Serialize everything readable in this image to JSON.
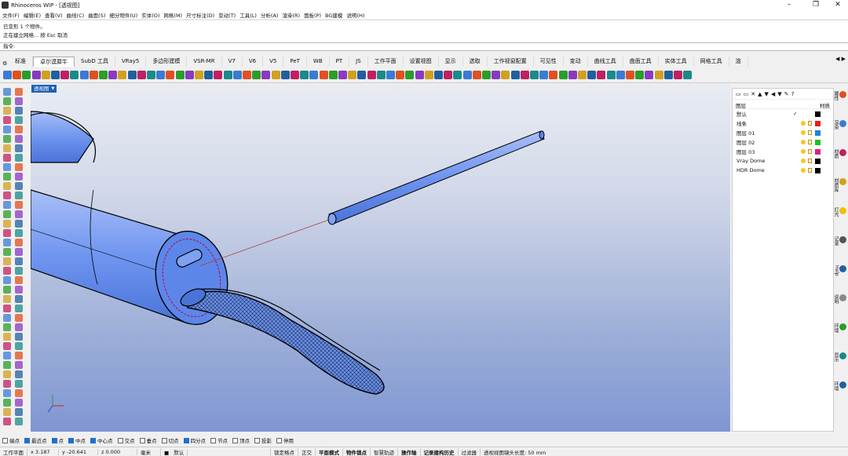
{
  "window": {
    "title": "Rhinoceros WIP - [透视图]"
  },
  "menu": [
    "文件(F)",
    "编辑(E)",
    "查看(V)",
    "曲线(C)",
    "曲面(S)",
    "细分物件(U)",
    "实体(O)",
    "网格(M)",
    "尺寸标注(D)",
    "变动(T)",
    "工具(L)",
    "分析(A)",
    "渲染(R)",
    "面板(P)",
    "BG建模",
    "说明(H)"
  ],
  "command_history": [
    "已变形 1 个物件。",
    "正在建立网格... 按 Esc 取消"
  ],
  "command_prompt": "指令:",
  "tabs": [
    "标准",
    "卓尔谟犀牛",
    "SubD 工具",
    "VRay5",
    "多边形建模",
    "VSR-MR",
    "V7",
    "V6",
    "V5",
    "PeT",
    "WB",
    "PT",
    "JS",
    "工作平面",
    "设置视图",
    "显示",
    "选取",
    "工作视窗配置",
    "可见性",
    "变动",
    "曲线工具",
    "曲面工具",
    "实体工具",
    "网格工具",
    "渲"
  ],
  "active_tab": "卓尔谟犀牛",
  "viewport": {
    "label": "透视图"
  },
  "layers_panel": {
    "header_left": "图层",
    "header_right": "材质",
    "layers": [
      {
        "name": "默认",
        "current": true,
        "color": "#000000"
      },
      {
        "name": "线条",
        "current": false,
        "color": "#e02020"
      },
      {
        "name": "图层 01",
        "current": false,
        "color": "#1e7fe0"
      },
      {
        "name": "图层 02",
        "current": false,
        "color": "#20c020"
      },
      {
        "name": "图层 03",
        "current": false,
        "color": "#e0207a"
      },
      {
        "name": "Vray Dome",
        "current": false,
        "color": "#000000"
      },
      {
        "name": "HDR Dome",
        "current": false,
        "color": "#000000"
      }
    ]
  },
  "side_tabs": [
    "属性",
    "渲染",
    "材质",
    "材质库",
    "灯光",
    "记录",
    "Help",
    "说明",
    "环境",
    "显示",
    "环境"
  ],
  "osnaps": [
    {
      "label": "端点",
      "on": false
    },
    {
      "label": "最近点",
      "on": true
    },
    {
      "label": "点",
      "on": true
    },
    {
      "label": "中点",
      "on": true
    },
    {
      "label": "中心点",
      "on": true
    },
    {
      "label": "交点",
      "on": false
    },
    {
      "label": "垂点",
      "on": false
    },
    {
      "label": "切点",
      "on": false
    },
    {
      "label": "四分点",
      "on": true
    },
    {
      "label": "节点",
      "on": false
    },
    {
      "label": "顶点",
      "on": false
    },
    {
      "label": "投影",
      "on": false
    },
    {
      "label": "停用",
      "on": false
    }
  ],
  "status": {
    "cplane": "工作平面",
    "x": "x 3.187",
    "y": "y -20.641",
    "z": "z 0.000",
    "unit": "毫米",
    "layer": "默认",
    "items": [
      "锁定格点",
      "正交",
      "平面模式",
      "物件锁点",
      "智慧轨迹",
      "操作轴",
      "记录建构历史",
      "过滤器"
    ],
    "bold_items": [
      false,
      false,
      true,
      true,
      false,
      true,
      true,
      false
    ],
    "message": "透视视图镜头长度: 50 mm"
  }
}
